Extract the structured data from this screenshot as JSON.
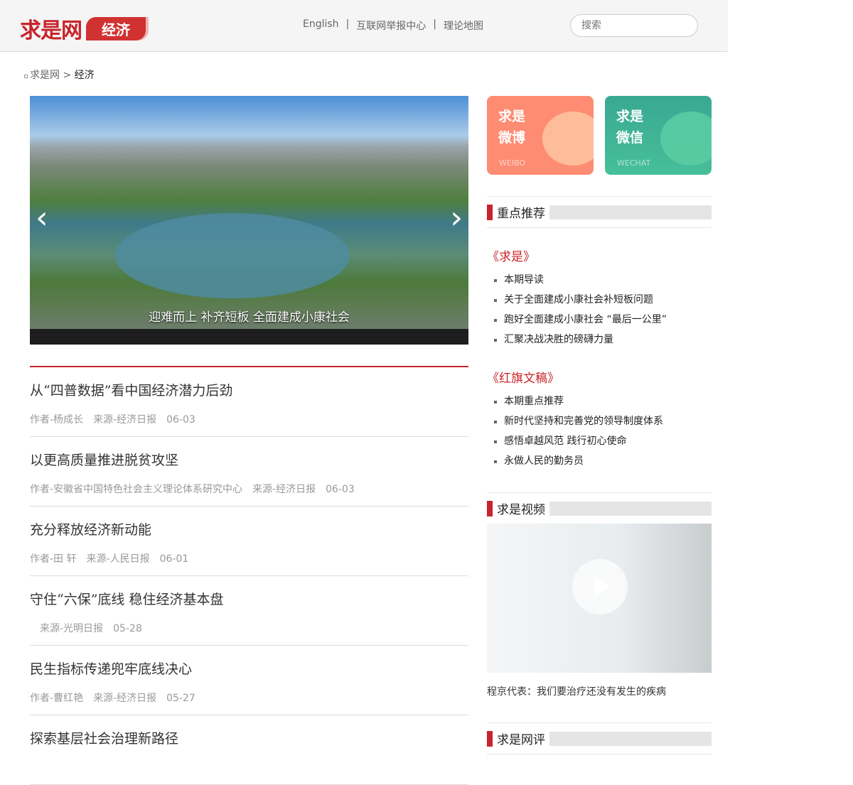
{
  "header": {
    "logo": "求是网",
    "logo_tag": "经济",
    "nav": [
      "English",
      "互联网举报中心",
      "理论地图"
    ],
    "search_placeholder": "搜索"
  },
  "breadcrumb": {
    "home": "求是网",
    "sep": ">",
    "current": "经济"
  },
  "slider": {
    "caption": "迎难而上 补齐短板 全面建成小康社会",
    "prev": "‹",
    "next": "›"
  },
  "news": [
    {
      "title": "从“四普数据”看中国经济潜力后劲",
      "author": "作者-杨成长",
      "source": "来源-经济日报",
      "date": "06-03"
    },
    {
      "title": "以更高质量推进脱贫攻坚",
      "author": "作者-安徽省中国特色社会主义理论体系研究中心",
      "source": "来源-经济日报",
      "date": "06-03"
    },
    {
      "title": "充分释放经济新动能",
      "author": "作者-田 轩",
      "source": "来源-人民日报",
      "date": "06-01"
    },
    {
      "title": "守住“六保”底线 稳住经济基本盘",
      "author": "",
      "source": "来源-光明日报",
      "date": "05-28"
    },
    {
      "title": "民生指标传递兜牢底线决心",
      "author": "作者-曹红艳",
      "source": "来源-经济日报",
      "date": "05-27"
    },
    {
      "title": "探索基层社会治理新路径",
      "author": "",
      "source": "",
      "date": ""
    }
  ],
  "cards": {
    "weibo": {
      "title": "求是微博",
      "sub": "WEIBO"
    },
    "wechat": {
      "title": "求是微信",
      "sub": "WECHAT"
    }
  },
  "featured": {
    "title": "重点推荐",
    "mag1": "《求是》",
    "mag1_items": [
      "本期导读",
      "关于全面建成小康社会补短板问题",
      "跑好全面建成小康社会 “最后一公里”",
      "汇聚决战决胜的磅礴力量"
    ],
    "mag2": "《红旗文稿》",
    "mag2_items": [
      "本期重点推荐",
      "新时代坚持和完善党的领导制度体系",
      "感悟卓越风范 践行初心使命",
      "永做人民的勤务员"
    ]
  },
  "video": {
    "title": "求是视频",
    "caption": "程京代表：我们要治疗还没有发生的疾病"
  },
  "review": {
    "title": "求是网评"
  }
}
